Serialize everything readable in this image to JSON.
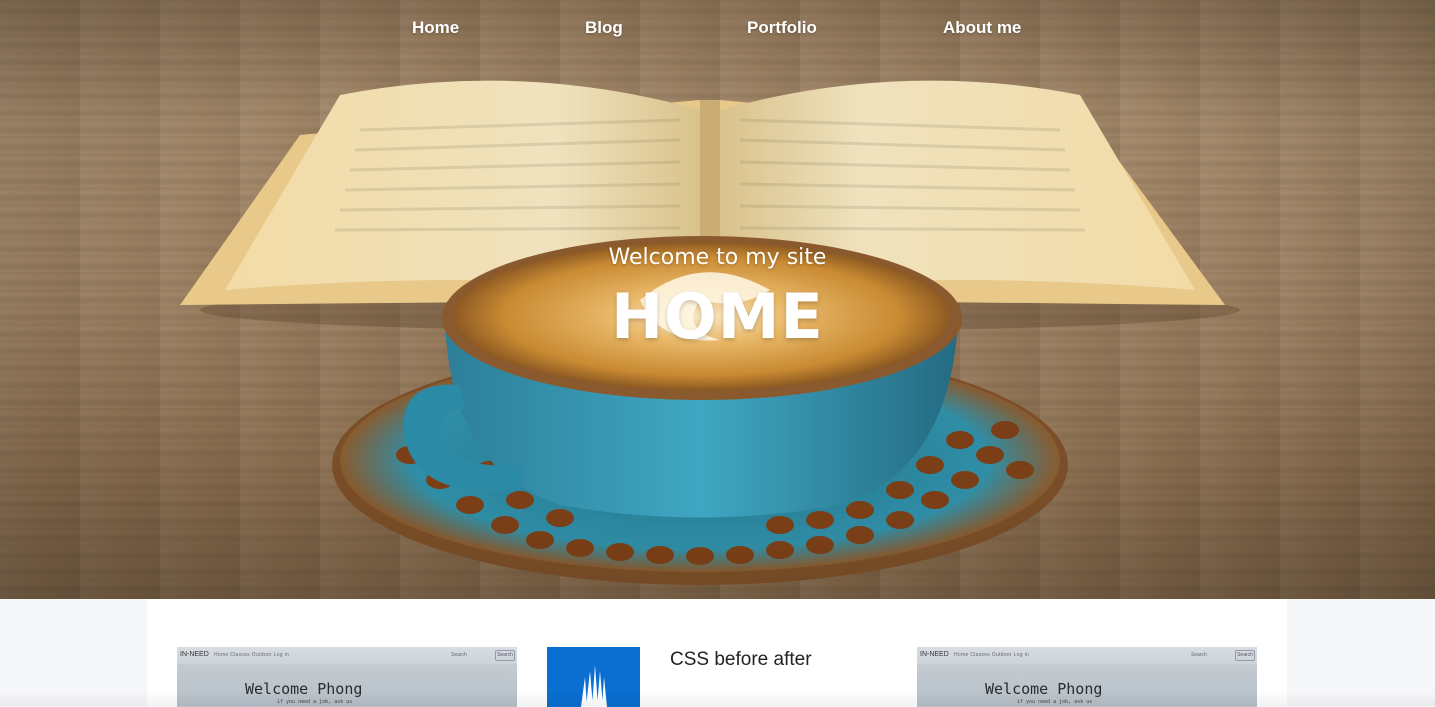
{
  "nav": {
    "items": [
      {
        "label": "Home"
      },
      {
        "label": "Blog"
      },
      {
        "label": "Portfolio"
      },
      {
        "label": "About me"
      }
    ]
  },
  "hero": {
    "subtitle": "Welcome to my site",
    "title": "HOME",
    "image": "coffee-cup-and-open-book-on-wooden-table"
  },
  "posts": [
    {
      "thumb": {
        "brand": "IN-NEED",
        "links": "Home  Classes  Outdoor  Log in",
        "search_label": "Search",
        "search_button": "Search",
        "heading": "Welcome Phong",
        "tagline": "if you need a job, ask us"
      }
    },
    {
      "title": "CSS before after",
      "image": "blue-cathedral-icon"
    },
    {
      "thumb": {
        "brand": "IN-NEED",
        "links": "Home  Classes  Outdoor  Log in",
        "search_label": "Search",
        "search_button": "Search",
        "heading": "Welcome Phong",
        "tagline": "if you need a job, ask us"
      }
    }
  ],
  "colors": {
    "content_bg": "#ffffff",
    "page_bg": "#f6f7f9",
    "accent_blue": "#0a6fd0",
    "nav_text": "#ffffff"
  }
}
